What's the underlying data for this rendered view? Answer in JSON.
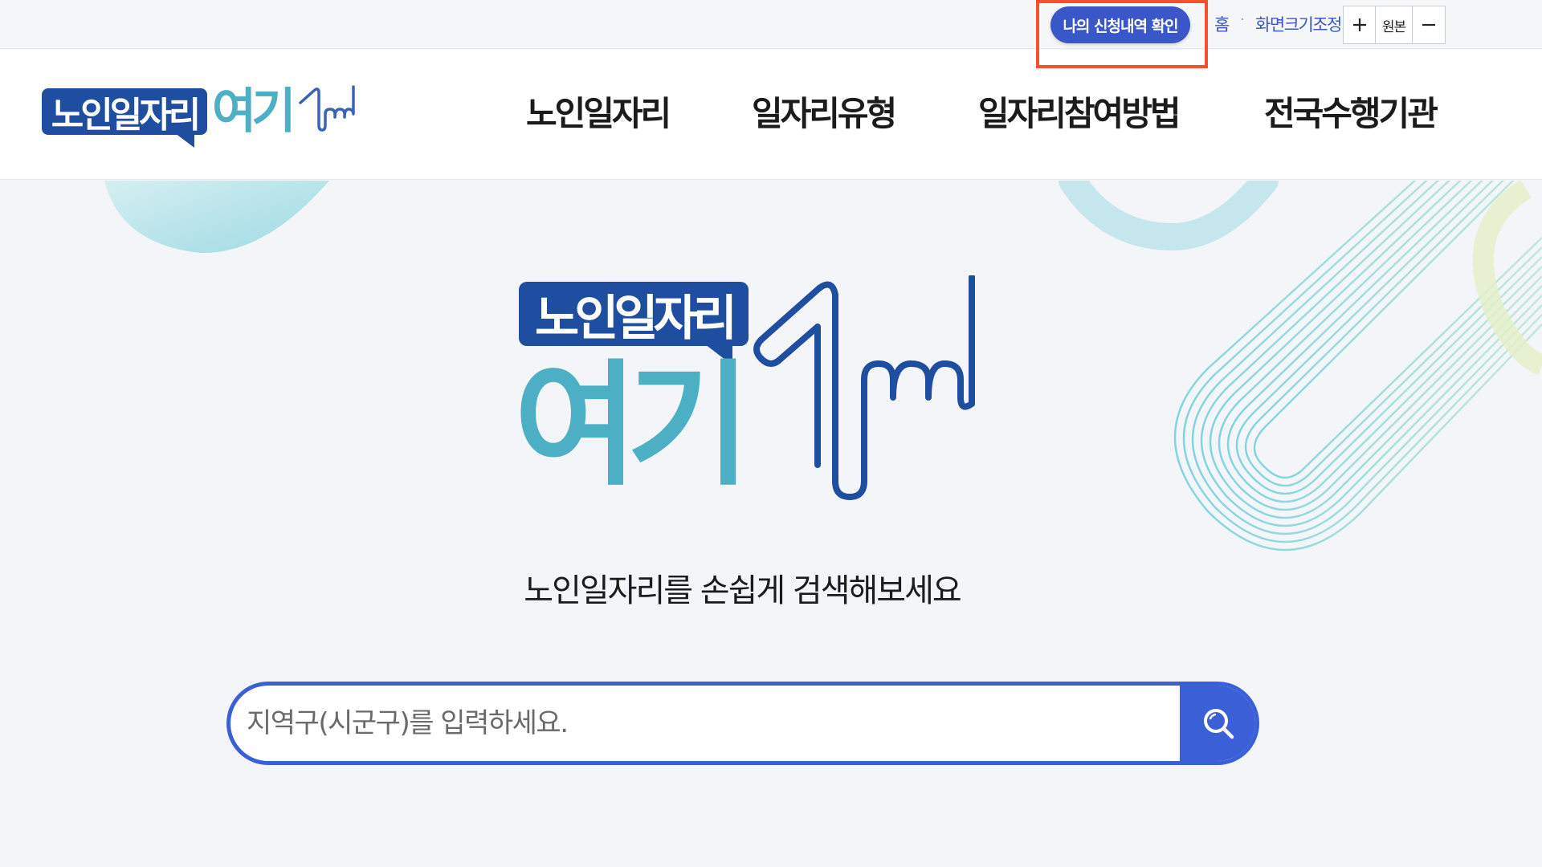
{
  "utility_bar": {
    "my_application_button": "나의 신청내역 확인",
    "home_link": "홈",
    "separator": "·",
    "screen_resize_label": "화면크기조정",
    "zoom_in": "+",
    "zoom_original": "원본",
    "zoom_out": "—"
  },
  "header": {
    "logo_badge_text": "노인일자리",
    "logo_word_text": "여기",
    "nav": [
      {
        "label": "노인일자리"
      },
      {
        "label": "일자리유형"
      },
      {
        "label": "일자리참여방법"
      },
      {
        "label": "전국수행기관"
      }
    ]
  },
  "hero": {
    "logo_badge_text": "노인일자리",
    "logo_word_text": "여기",
    "subtitle": "노인일자리를 손쉽게 검색해보세요",
    "search": {
      "placeholder": "지역구(시군구)를 입력하세요.",
      "value": ""
    }
  },
  "colors": {
    "brand_navy": "#1f4ea0",
    "brand_teal": "#4dafc4",
    "accent_blue": "#3a5fd6",
    "button_blue": "#3a57c9",
    "highlight_red": "#f4512c",
    "background": "#f3f5f8"
  },
  "icons": {
    "search": "search-icon",
    "plus": "plus-icon",
    "minus": "minus-icon"
  }
}
